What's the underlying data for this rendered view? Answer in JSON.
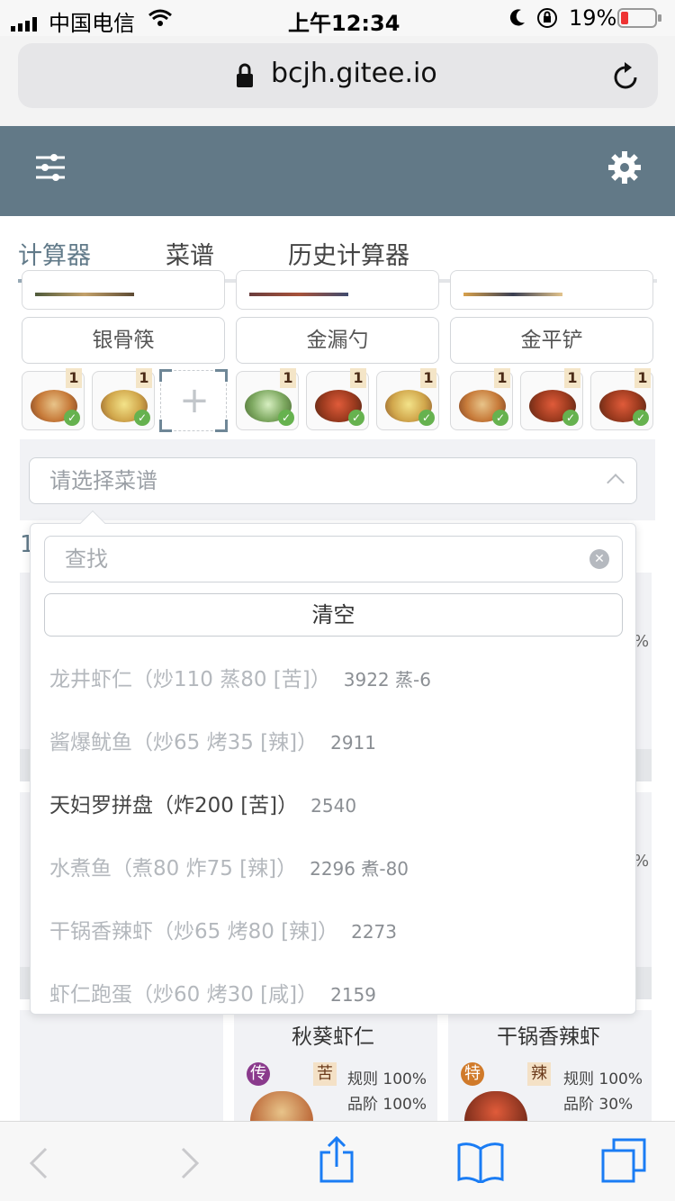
{
  "status": {
    "carrier": "中国电信",
    "time": "上午12:34",
    "battery": "19%"
  },
  "browser": {
    "url": "bcjh.gitee.io"
  },
  "tabs": [
    {
      "label": "计算器"
    },
    {
      "label": "菜谱"
    },
    {
      "label": "历史计算器"
    }
  ],
  "equipment": [
    "银骨筷",
    "金漏勺",
    "金平铲"
  ],
  "dish_badge": "1",
  "selector": {
    "placeholder": "请选择菜谱"
  },
  "dropdown": {
    "search_placeholder": "查找",
    "clear_label": "清空",
    "options": [
      {
        "name": "龙井虾仁（炒110 蒸80 [苦]）",
        "extra": "3922 蒸-6"
      },
      {
        "name": "酱爆鱿鱼（炒65 烤35 [辣]）",
        "extra": "2911"
      },
      {
        "name": "天妇罗拼盘（炸200 [苦]）",
        "extra": "2540"
      },
      {
        "name": "水煮鱼（煮80 炸75 [辣]）",
        "extra": "2296 煮-80"
      },
      {
        "name": "干锅香辣虾（炒65 烤80 [辣]）",
        "extra": "2273"
      },
      {
        "name": "虾仁跑蛋（炒60 烤30 [咸]）",
        "extra": "2159"
      }
    ]
  },
  "bottom_cards": [
    {
      "title": "秋葵虾仁",
      "rarity": "传",
      "flavor": "苦",
      "rule": "规则 100%",
      "grade": "品阶 100%"
    },
    {
      "title": "干锅香辣虾",
      "rarity": "特",
      "flavor": "辣",
      "rule": "规则 100%",
      "grade": "品阶 30%"
    }
  ],
  "peek_percent": "%",
  "colors": {
    "header": "#627987",
    "accent": "#617a89"
  }
}
